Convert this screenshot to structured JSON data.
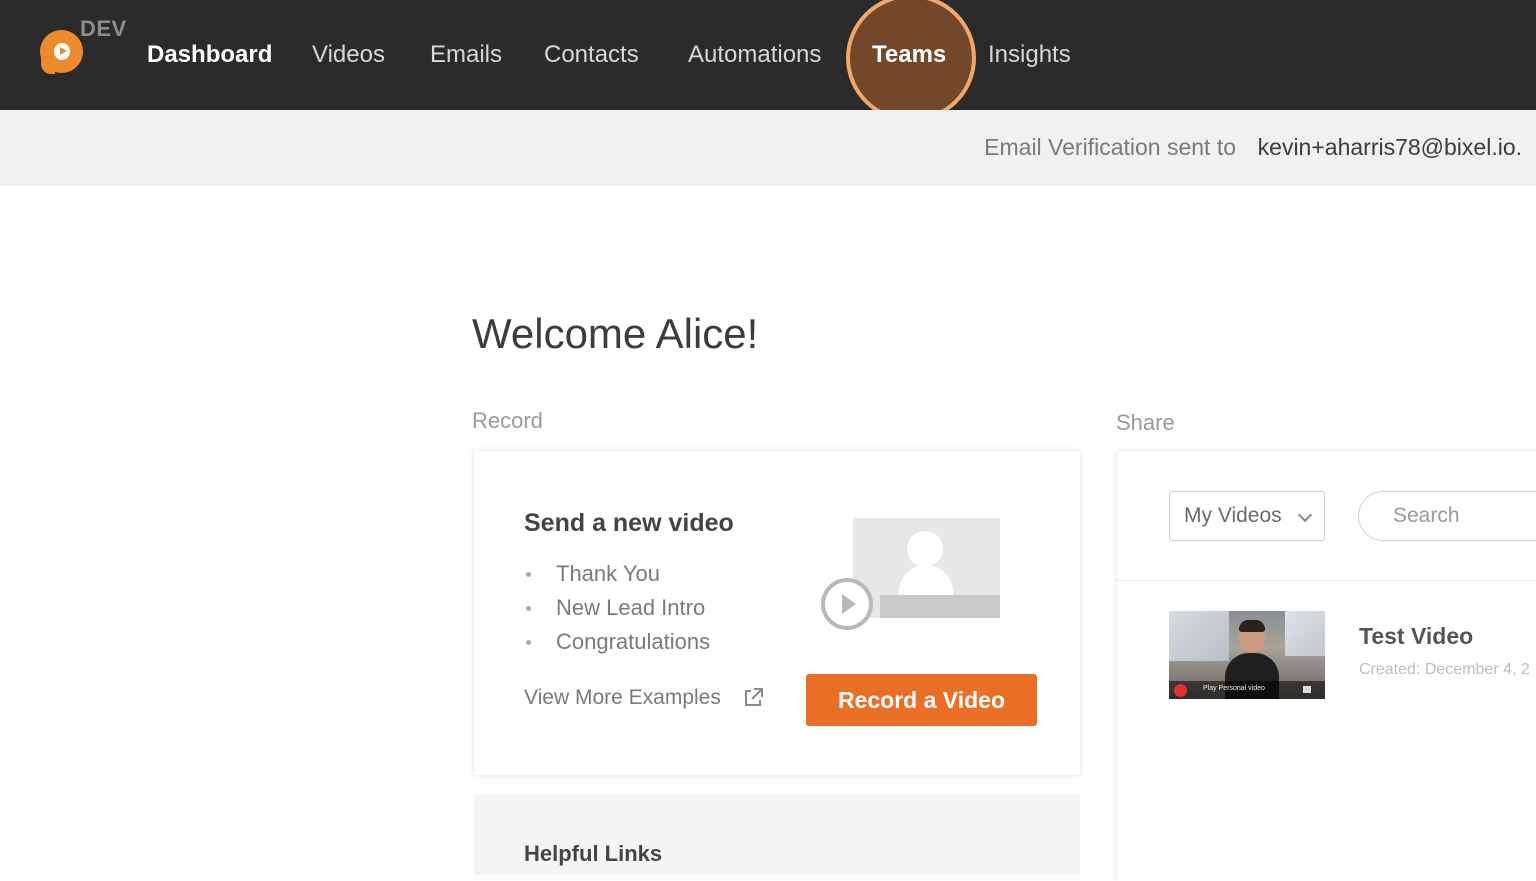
{
  "app": {
    "env_tag": "DEV",
    "brand_color": "#ec8a2c",
    "logo_icon": "play-bubble-icon"
  },
  "nav": {
    "items": [
      {
        "label": "Dashboard",
        "active": true
      },
      {
        "label": "Videos"
      },
      {
        "label": "Emails"
      },
      {
        "label": "Contacts"
      },
      {
        "label": "Automations"
      },
      {
        "label": "Teams",
        "highlighted": true
      },
      {
        "label": "Insights"
      }
    ]
  },
  "verification": {
    "text": "Email Verification sent to",
    "email": "kevin+aharris78@bixel.io."
  },
  "welcome": "Welcome Alice!",
  "record": {
    "section_label": "Record",
    "card_title": "Send a new video",
    "examples": [
      "Thank You",
      "New Lead Intro",
      "Congratulations"
    ],
    "more_link": "View More Examples",
    "button_label": "Record a Video",
    "button_color": "#ec6f27"
  },
  "share": {
    "section_label": "Share",
    "filter_value": "My Videos",
    "search_placeholder": "Search",
    "videos": [
      {
        "title": "Test Video",
        "meta": "Created: December 4, 2",
        "thumb_caption": "Play Personal video"
      }
    ]
  },
  "helpful": {
    "title": "Helpful Links"
  }
}
